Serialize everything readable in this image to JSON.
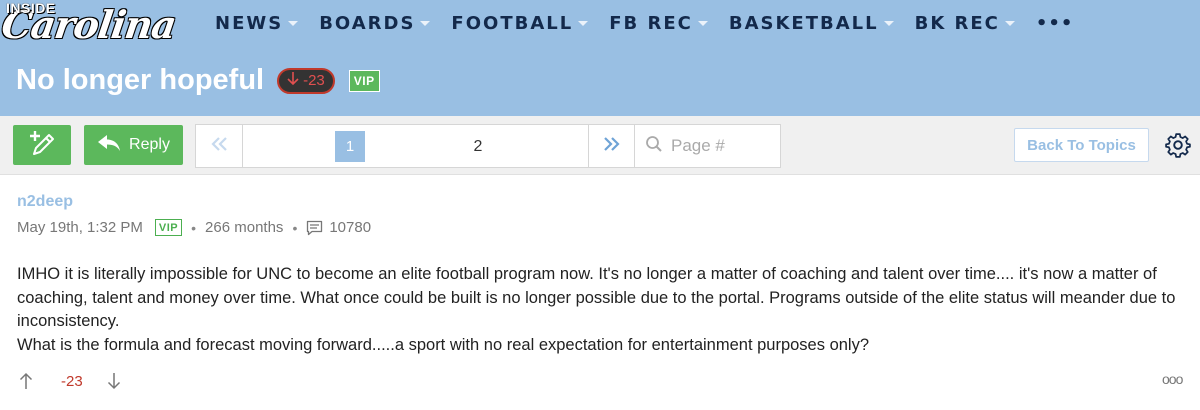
{
  "site": {
    "logo_top": "INSIDE",
    "logo_main": "Carolina"
  },
  "nav": {
    "items": [
      {
        "label": "NEWS"
      },
      {
        "label": "BOARDS"
      },
      {
        "label": "FOOTBALL"
      },
      {
        "label": "FB REC"
      },
      {
        "label": "BASKETBALL"
      },
      {
        "label": "BK REC"
      }
    ],
    "more_label": "•••"
  },
  "thread": {
    "title": "No longer hopeful",
    "score": "-23",
    "vip_label": "VIP"
  },
  "toolbar": {
    "reply_label": "Reply",
    "pages": {
      "current": "1",
      "other": "2"
    },
    "page_placeholder": "Page #",
    "back_label": "Back To Topics"
  },
  "post": {
    "author": "n2deep",
    "date": "May 19th, 1:32 PM",
    "vip_label": "VIP",
    "tenure": "266 months",
    "post_count": "10780",
    "body_lines": [
      "IMHO it is literally impossible for UNC to become an elite football program now. It's no longer a matter of coaching and talent over time.... it's now a matter of coaching, talent and money over time. What once could be built is no longer possible due to the portal. Programs outside of the elite status will meander due to inconsistency.",
      "What is the formula and forecast moving forward.....a sport with no real expectation for entertainment purposes only?"
    ],
    "score": "-23",
    "more_label": "ooo"
  },
  "colors": {
    "header_bg": "#99bfe3",
    "green": "#5cb85c",
    "negative": "#c0392b"
  }
}
